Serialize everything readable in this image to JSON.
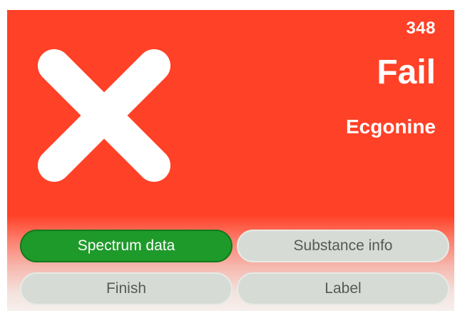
{
  "status": {
    "counter": "348",
    "result": "Fail",
    "substance_name": "Ecgonine",
    "icon": "x-mark-icon"
  },
  "buttons": {
    "spectrum_data": "Spectrum data",
    "substance_info": "Substance info",
    "finish": "Finish",
    "label": "Label"
  },
  "colors": {
    "fail_background": "#ff4127",
    "active_button": "#1e9a2a",
    "inactive_button": "#d7dbd6",
    "text_on_background": "#ffffff"
  }
}
